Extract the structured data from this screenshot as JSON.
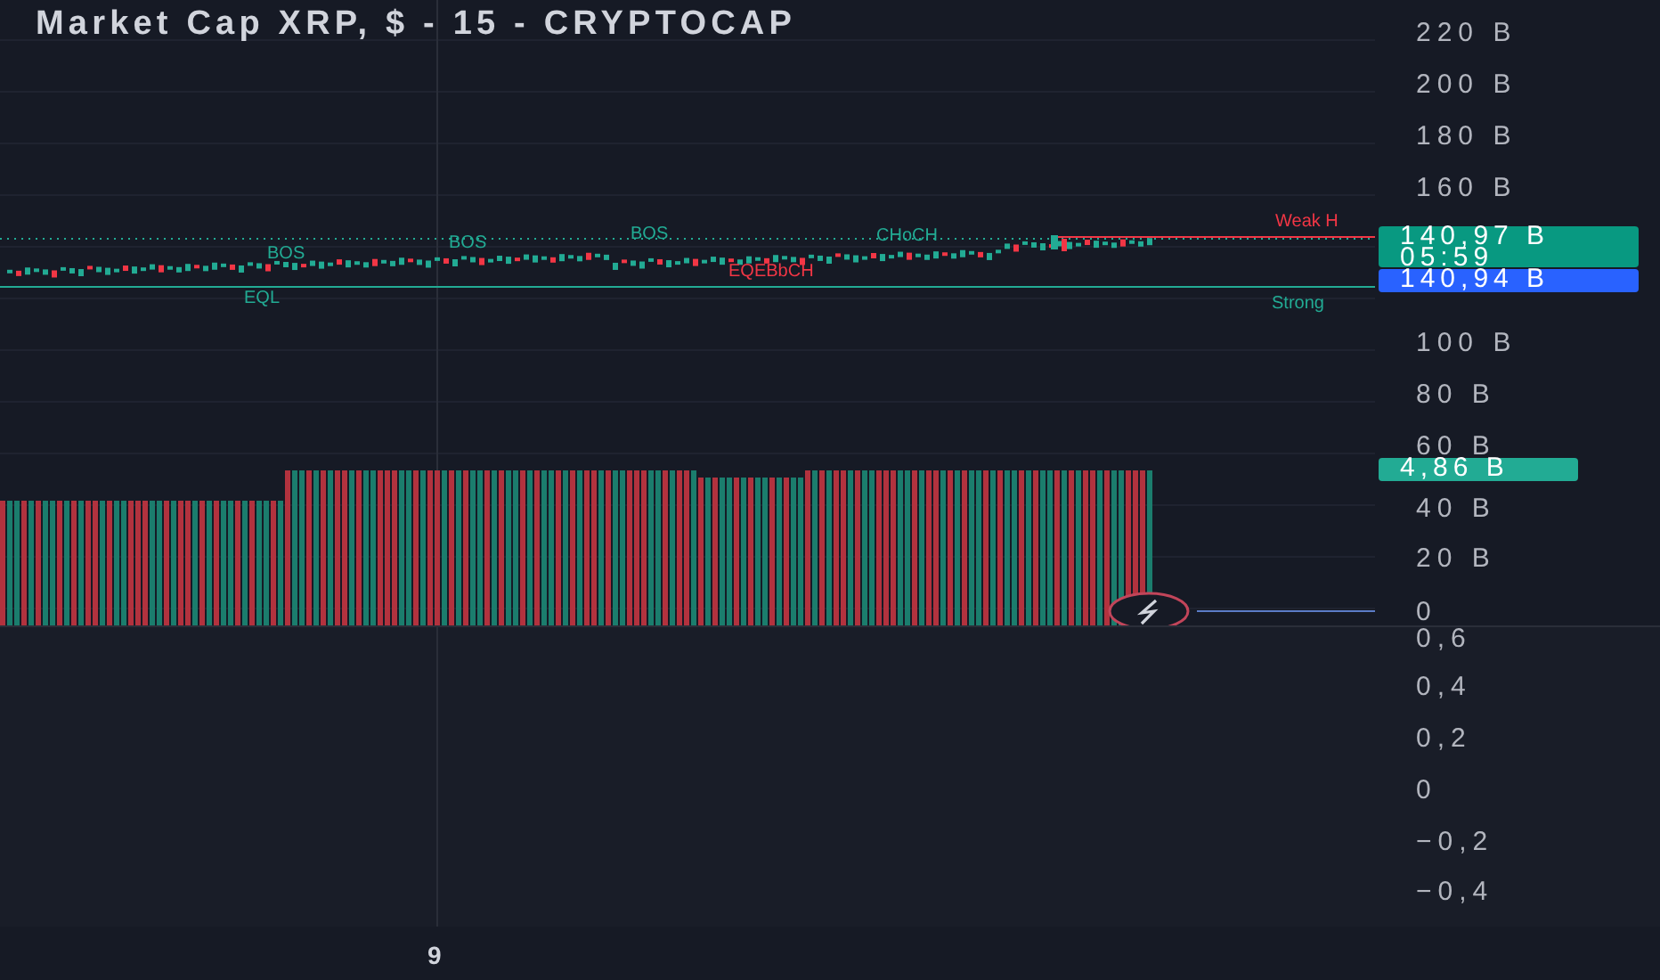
{
  "header": {
    "title": "Market Cap XRP, $ - 15 - CRYPTOCAP"
  },
  "price_pane": {
    "annotations": [
      {
        "text": "BOS",
        "color": "#22ab94"
      },
      {
        "text": "BOS",
        "color": "#22ab94"
      },
      {
        "text": "BOS",
        "color": "#22ab94"
      },
      {
        "text": "CHoCH",
        "color": "#22ab94"
      },
      {
        "text": "EQL",
        "color": "#22ab94"
      },
      {
        "text": "EQEBbCH",
        "color": "#f23645"
      },
      {
        "text": "Weak H",
        "color": "#f23645"
      },
      {
        "text": "Strong",
        "color": "#22ab94"
      }
    ]
  },
  "price_axis": {
    "labels": [
      "220 B",
      "200 B",
      "180 B",
      "160 B",
      "100 B",
      "80 B",
      "60 B",
      "40 B",
      "20 B",
      "0"
    ],
    "badges": [
      {
        "kind": "last_price",
        "value": "140,97 B",
        "countdown": "05:59"
      },
      {
        "kind": "price",
        "value": "140,94 B"
      },
      {
        "kind": "volume",
        "value": "4,86 B"
      }
    ]
  },
  "oscillator_axis": {
    "labels": [
      "0,6",
      "0,4",
      "0,2",
      "0",
      "−0,2",
      "−0,4"
    ]
  },
  "time_axis": {
    "labels": [
      "9"
    ]
  }
}
